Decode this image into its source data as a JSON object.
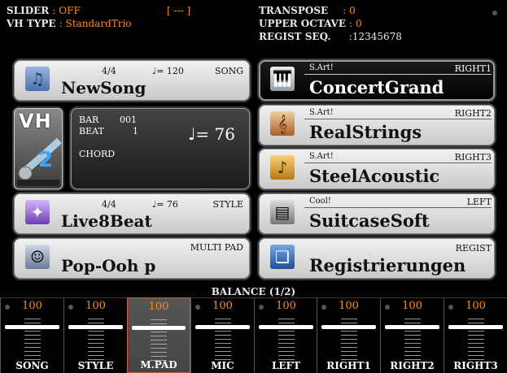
{
  "header": {
    "slider_label": "SLIDER",
    "slider_value": ": OFF",
    "slider_bracket": "[ --- ]",
    "vh_type_label": "VH TYPE",
    "vh_type_value": ": StandardTrio",
    "transpose_label": "TRANSPOSE",
    "transpose_value": ": 0",
    "upper_octave_label": "UPPER OCTAVE",
    "upper_octave_value": ": 0",
    "regist_seq_label": "REGIST SEQ.",
    "regist_seq_value": ":12345678"
  },
  "song": {
    "time_sig": "4/4",
    "tempo": "♩= 120",
    "tag": "SONG",
    "name": "NewSong",
    "icon": "music-note-icon"
  },
  "transport": {
    "bar_label": "BAR",
    "bar_value": "001",
    "beat_label": "BEAT",
    "beat_value": "1",
    "chord_label": "CHORD",
    "tempo": "♩= 76"
  },
  "vocal_harmony": {
    "label": "VH",
    "icon": "microphone-icon"
  },
  "style": {
    "time_sig": "4/4",
    "tempo": "♩= 76",
    "tag": "STYLE",
    "name": "Live8Beat",
    "icon": "concert-icon"
  },
  "multipad": {
    "tag": "MULTI PAD",
    "name": "Pop-Ooh p",
    "icon": "singer-icon"
  },
  "parts": [
    {
      "sub": "S.Art!",
      "tag": "RIGHT1",
      "name": "ConcertGrand",
      "icon": "piano-icon",
      "selected": true
    },
    {
      "sub": "S.Art!",
      "tag": "RIGHT2",
      "name": "RealStrings",
      "icon": "violin-icon",
      "selected": false
    },
    {
      "sub": "S.Art!",
      "tag": "RIGHT3",
      "name": "SteelAcoustic",
      "icon": "guitar-icon",
      "selected": false
    },
    {
      "sub": "Cool!",
      "tag": "LEFT",
      "name": "SuitcaseSoft",
      "icon": "electric-piano-icon",
      "selected": false
    },
    {
      "sub": "",
      "tag": "REGIST",
      "name": "Registrierungen",
      "icon": "registration-icon",
      "selected": false
    }
  ],
  "balance": {
    "title": "BALANCE (1/2)",
    "channels": [
      {
        "label": "SONG",
        "value": "100",
        "level": 0.85,
        "selected": false
      },
      {
        "label": "STYLE",
        "value": "100",
        "level": 0.85,
        "selected": false
      },
      {
        "label": "M.PAD",
        "value": "100",
        "level": 0.85,
        "selected": true
      },
      {
        "label": "MIC",
        "value": "100",
        "level": 0.85,
        "selected": false
      },
      {
        "label": "LEFT",
        "value": "100",
        "level": 0.85,
        "selected": false
      },
      {
        "label": "RIGHT1",
        "value": "100",
        "level": 0.85,
        "selected": false
      },
      {
        "label": "RIGHT2",
        "value": "100",
        "level": 0.85,
        "selected": false
      },
      {
        "label": "RIGHT3",
        "value": "100",
        "level": 0.85,
        "selected": false
      }
    ]
  },
  "colors": {
    "accent": "#ff8a1f",
    "selected_border": "#d2573c"
  }
}
